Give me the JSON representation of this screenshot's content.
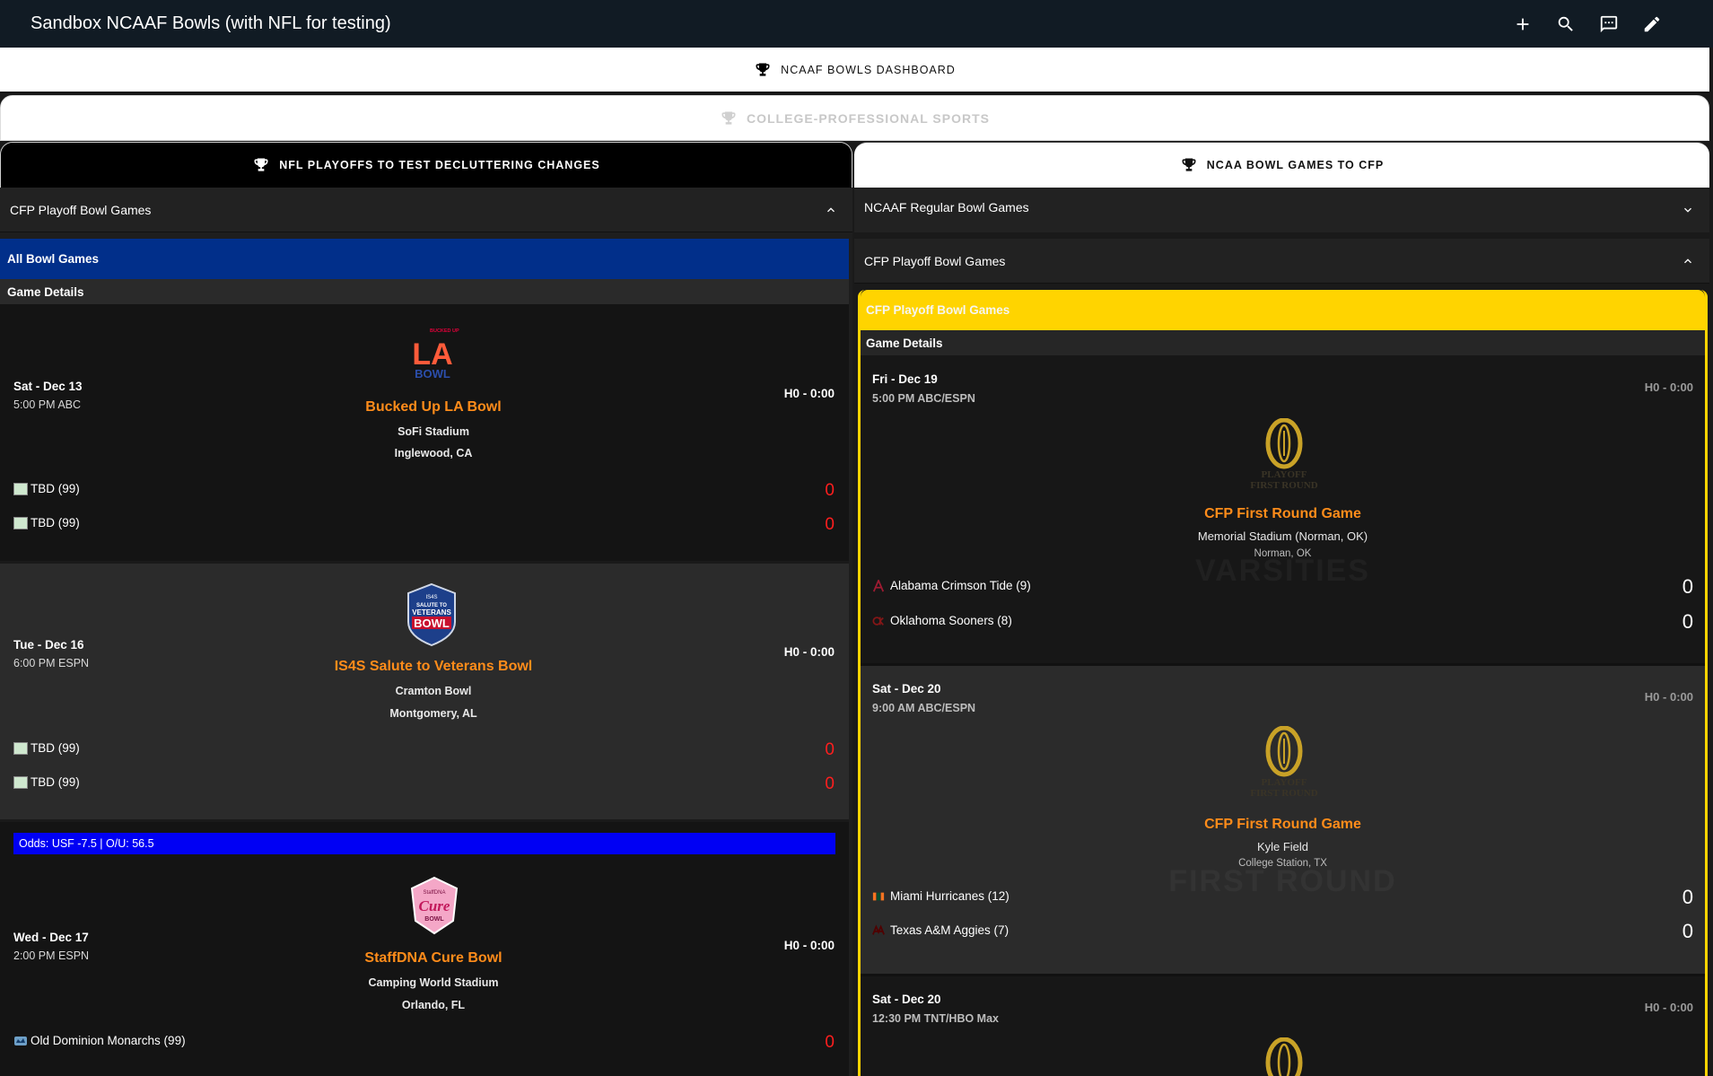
{
  "app": {
    "title": "Sandbox NCAAF Bowls (with NFL for testing)"
  },
  "toolbar": {
    "add": "plus-icon",
    "search": "search-icon",
    "feedback": "comment-icon",
    "edit": "pencil-icon"
  },
  "tabs": {
    "dashboard": "NCAAF BOWLS DASHBOARD",
    "college": "COLLEGE-PROFESSIONAL SPORTS",
    "nfl": "NFL PLAYOFFS TO TEST DECLUTTERING CHANGES",
    "ncaa": "NCAA BOWL GAMES TO CFP"
  },
  "left": {
    "accordion": "CFP Playoff Bowl Games",
    "band": "All Bowl Games",
    "details_header": "Game Details",
    "odds": "Odds: USF -7.5 | O/U: 56.5",
    "games": [
      {
        "date": "Sat - Dec 13",
        "tv": "5:00 PM ABC",
        "home_score": "H0 - 0:00",
        "bowl": "Bucked Up LA Bowl",
        "venue": "SoFi Stadium",
        "city": "Inglewood, CA",
        "team1": "TBD (99)",
        "team2": "TBD (99)",
        "score1": "0",
        "score2": "0"
      },
      {
        "date": "Tue - Dec 16",
        "tv": "6:00 PM ESPN",
        "home_score": "H0 - 0:00",
        "bowl": "IS4S Salute to Veterans Bowl",
        "venue": "Cramton Bowl",
        "city": "Montgomery, AL",
        "team1": "TBD (99)",
        "team2": "TBD (99)",
        "score1": "0",
        "score2": "0"
      },
      {
        "date": "Wed - Dec 17",
        "tv": "2:00 PM ESPN",
        "home_score": "H0 - 0:00",
        "bowl": "StaffDNA Cure Bowl",
        "venue": "Camping World Stadium",
        "city": "Orlando, FL",
        "team1": "Old Dominion Monarchs (99)",
        "score1": "0"
      }
    ],
    "logo_texts": {
      "la_top": "BUCKED UP",
      "la_main": "LA",
      "la_sub": "BOWL",
      "vet_top": "IS4S",
      "vet_line": "SALUTE TO",
      "vet_mid": "VETERANS",
      "vet_main": "BOWL",
      "cure_top": "StaffDNA",
      "cure_main": "Cure",
      "cure_sub": "BOWL"
    }
  },
  "right": {
    "accordion_regular": "NCAAF Regular Bowl Games",
    "accordion_cfp": "CFP Playoff Bowl Games",
    "band": "CFP Playoff Bowl Games",
    "details_header": "Game Details",
    "cfp_logo_line1": "PLAYOFF",
    "cfp_logo_line2": "FIRST ROUND",
    "watermark1": "VARSITIES",
    "watermark2": "FIRST ROUND",
    "games": [
      {
        "date": "Fri - Dec 19",
        "tv": "5:00 PM ABC/ESPN",
        "home_score": "H0 - 0:00",
        "bowl": "CFP First Round Game",
        "venue": "Memorial Stadium (Norman, OK)",
        "city": "Norman, OK",
        "team1": "Alabama Crimson Tide (9)",
        "team2": "Oklahoma Sooners (8)",
        "score1": "0",
        "score2": "0"
      },
      {
        "date": "Sat - Dec 20",
        "tv": "9:00 AM ABC/ESPN",
        "home_score": "H0 - 0:00",
        "bowl": "CFP First Round Game",
        "venue": "Kyle Field",
        "city": "College Station, TX",
        "team1": "Miami Hurricanes (12)",
        "team2": "Texas A&M Aggies (7)",
        "score1": "0",
        "score2": "0"
      },
      {
        "date": "Sat - Dec 20",
        "tv": "12:30 PM TNT/HBO Max",
        "home_score": "H0 - 0:00"
      }
    ]
  },
  "colors": {
    "accent_blue": "#012f8a",
    "odds_blue": "#0000f4",
    "cfp_yellow": "#ffd400",
    "bowl_orange": "#ff8c1a",
    "score_red": "#ff1e1e",
    "appbar": "#111b24"
  }
}
